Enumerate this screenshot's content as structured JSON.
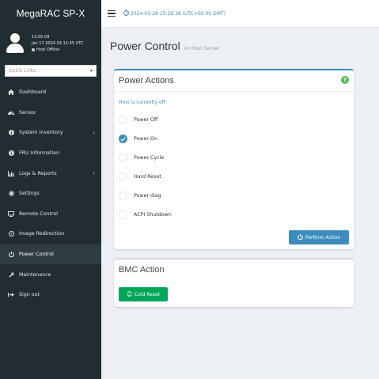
{
  "sidebar": {
    "brand": "MegaRAC SP-X",
    "user": {
      "version": "13.05.09",
      "datetime": "Jan 17 2024 02:11:35 UTC",
      "status": "Host Offline"
    },
    "quick_links_placeholder": "Quick Links..",
    "items": [
      {
        "label": "Dashboard",
        "icon": "home-icon"
      },
      {
        "label": "Sensor",
        "icon": "sensor-icon"
      },
      {
        "label": "System Inventory",
        "icon": "info-icon",
        "has_submenu": true
      },
      {
        "label": "FRU Information",
        "icon": "info-icon"
      },
      {
        "label": "Logs & Reports",
        "icon": "chart-icon",
        "has_submenu": true
      },
      {
        "label": "Settings",
        "icon": "gear-icon"
      },
      {
        "label": "Remote Control",
        "icon": "monitor-icon"
      },
      {
        "label": "Image Redirection",
        "icon": "disc-icon"
      },
      {
        "label": "Power Control",
        "icon": "power-icon",
        "active": true
      },
      {
        "label": "Maintenance",
        "icon": "wrench-icon"
      },
      {
        "label": "Sign out",
        "icon": "sign-out-icon"
      }
    ]
  },
  "topbar": {
    "datetime": "2024-03-28 15:26:18 (UTC+00:00 GMT)"
  },
  "page": {
    "title": "Power Control",
    "subtitle": "on Host Server"
  },
  "power_actions": {
    "title": "Power Actions",
    "status": "Host is currently off",
    "options": [
      {
        "label": "Power Off",
        "checked": false
      },
      {
        "label": "Power On",
        "checked": true
      },
      {
        "label": "Power Cycle",
        "checked": false
      },
      {
        "label": "Hard Reset",
        "checked": false
      },
      {
        "label": "Power diag",
        "checked": false
      },
      {
        "label": "ACPI Shutdown",
        "checked": false
      }
    ],
    "perform_label": "Perform Action"
  },
  "bmc_action": {
    "title": "BMC Action",
    "cold_reset_label": "Cold Reset"
  },
  "colors": {
    "sidebar_bg": "#222d32",
    "accent": "#3c8dbc",
    "success": "#00a65a"
  }
}
